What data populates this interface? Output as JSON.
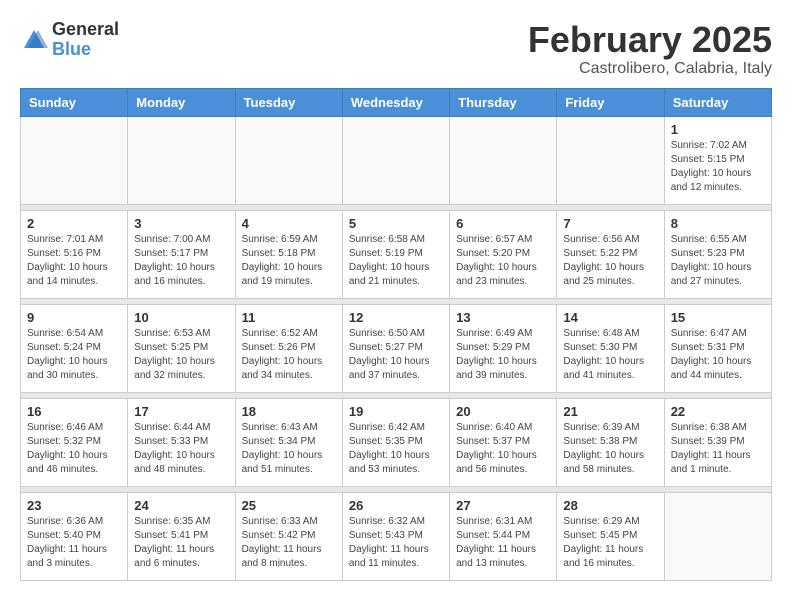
{
  "logo": {
    "general": "General",
    "blue": "Blue"
  },
  "title": "February 2025",
  "subtitle": "Castrolibero, Calabria, Italy",
  "weekdays": [
    "Sunday",
    "Monday",
    "Tuesday",
    "Wednesday",
    "Thursday",
    "Friday",
    "Saturday"
  ],
  "weeks": [
    [
      {
        "day": "",
        "info": ""
      },
      {
        "day": "",
        "info": ""
      },
      {
        "day": "",
        "info": ""
      },
      {
        "day": "",
        "info": ""
      },
      {
        "day": "",
        "info": ""
      },
      {
        "day": "",
        "info": ""
      },
      {
        "day": "1",
        "info": "Sunrise: 7:02 AM\nSunset: 5:15 PM\nDaylight: 10 hours\nand 12 minutes."
      }
    ],
    [
      {
        "day": "2",
        "info": "Sunrise: 7:01 AM\nSunset: 5:16 PM\nDaylight: 10 hours\nand 14 minutes."
      },
      {
        "day": "3",
        "info": "Sunrise: 7:00 AM\nSunset: 5:17 PM\nDaylight: 10 hours\nand 16 minutes."
      },
      {
        "day": "4",
        "info": "Sunrise: 6:59 AM\nSunset: 5:18 PM\nDaylight: 10 hours\nand 19 minutes."
      },
      {
        "day": "5",
        "info": "Sunrise: 6:58 AM\nSunset: 5:19 PM\nDaylight: 10 hours\nand 21 minutes."
      },
      {
        "day": "6",
        "info": "Sunrise: 6:57 AM\nSunset: 5:20 PM\nDaylight: 10 hours\nand 23 minutes."
      },
      {
        "day": "7",
        "info": "Sunrise: 6:56 AM\nSunset: 5:22 PM\nDaylight: 10 hours\nand 25 minutes."
      },
      {
        "day": "8",
        "info": "Sunrise: 6:55 AM\nSunset: 5:23 PM\nDaylight: 10 hours\nand 27 minutes."
      }
    ],
    [
      {
        "day": "9",
        "info": "Sunrise: 6:54 AM\nSunset: 5:24 PM\nDaylight: 10 hours\nand 30 minutes."
      },
      {
        "day": "10",
        "info": "Sunrise: 6:53 AM\nSunset: 5:25 PM\nDaylight: 10 hours\nand 32 minutes."
      },
      {
        "day": "11",
        "info": "Sunrise: 6:52 AM\nSunset: 5:26 PM\nDaylight: 10 hours\nand 34 minutes."
      },
      {
        "day": "12",
        "info": "Sunrise: 6:50 AM\nSunset: 5:27 PM\nDaylight: 10 hours\nand 37 minutes."
      },
      {
        "day": "13",
        "info": "Sunrise: 6:49 AM\nSunset: 5:29 PM\nDaylight: 10 hours\nand 39 minutes."
      },
      {
        "day": "14",
        "info": "Sunrise: 6:48 AM\nSunset: 5:30 PM\nDaylight: 10 hours\nand 41 minutes."
      },
      {
        "day": "15",
        "info": "Sunrise: 6:47 AM\nSunset: 5:31 PM\nDaylight: 10 hours\nand 44 minutes."
      }
    ],
    [
      {
        "day": "16",
        "info": "Sunrise: 6:46 AM\nSunset: 5:32 PM\nDaylight: 10 hours\nand 46 minutes."
      },
      {
        "day": "17",
        "info": "Sunrise: 6:44 AM\nSunset: 5:33 PM\nDaylight: 10 hours\nand 48 minutes."
      },
      {
        "day": "18",
        "info": "Sunrise: 6:43 AM\nSunset: 5:34 PM\nDaylight: 10 hours\nand 51 minutes."
      },
      {
        "day": "19",
        "info": "Sunrise: 6:42 AM\nSunset: 5:35 PM\nDaylight: 10 hours\nand 53 minutes."
      },
      {
        "day": "20",
        "info": "Sunrise: 6:40 AM\nSunset: 5:37 PM\nDaylight: 10 hours\nand 56 minutes."
      },
      {
        "day": "21",
        "info": "Sunrise: 6:39 AM\nSunset: 5:38 PM\nDaylight: 10 hours\nand 58 minutes."
      },
      {
        "day": "22",
        "info": "Sunrise: 6:38 AM\nSunset: 5:39 PM\nDaylight: 11 hours\nand 1 minute."
      }
    ],
    [
      {
        "day": "23",
        "info": "Sunrise: 6:36 AM\nSunset: 5:40 PM\nDaylight: 11 hours\nand 3 minutes."
      },
      {
        "day": "24",
        "info": "Sunrise: 6:35 AM\nSunset: 5:41 PM\nDaylight: 11 hours\nand 6 minutes."
      },
      {
        "day": "25",
        "info": "Sunrise: 6:33 AM\nSunset: 5:42 PM\nDaylight: 11 hours\nand 8 minutes."
      },
      {
        "day": "26",
        "info": "Sunrise: 6:32 AM\nSunset: 5:43 PM\nDaylight: 11 hours\nand 11 minutes."
      },
      {
        "day": "27",
        "info": "Sunrise: 6:31 AM\nSunset: 5:44 PM\nDaylight: 11 hours\nand 13 minutes."
      },
      {
        "day": "28",
        "info": "Sunrise: 6:29 AM\nSunset: 5:45 PM\nDaylight: 11 hours\nand 16 minutes."
      },
      {
        "day": "",
        "info": ""
      }
    ]
  ]
}
